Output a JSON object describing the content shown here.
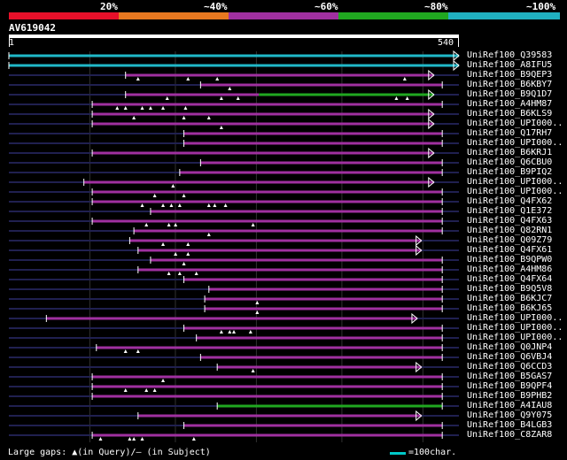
{
  "color_key": {
    "labels": [
      "20%",
      "~40%",
      "~60%",
      "~80%",
      "~100%"
    ],
    "colors": [
      "#e8102a",
      "#e87820",
      "#a030a0",
      "#20a820",
      "#20b0c0"
    ]
  },
  "query": {
    "name": "AV619042",
    "start": "1",
    "end": "540",
    "length": 540
  },
  "colors": {
    "hit": "#a030a0",
    "hit_cyan": "#20b8c8",
    "hit_green": "#20a820",
    "gap_line": "#202050",
    "grid": "#303030"
  },
  "legend": {
    "text": "Large gaps: ▲(in Query)/– (in Subject)",
    "scale_label": "=100char."
  },
  "hits": [
    {
      "name": "UniRef100_Q39583",
      "start": 0,
      "end": 540,
      "color": "cyan",
      "arrow": true,
      "marks": []
    },
    {
      "name": "UniRef100_A8IFU5",
      "start": 0,
      "end": 540,
      "color": "cyan",
      "arrow": true,
      "marks": []
    },
    {
      "name": "UniRef100_B9QEP3",
      "start": 140,
      "end": 510,
      "color": "purple",
      "arrow": true,
      "marks": [
        155,
        215,
        250,
        475
      ]
    },
    {
      "name": "UniRef100_B6KBY7",
      "start": 230,
      "end": 520,
      "color": "purple",
      "arrow": false,
      "marks": [
        265
      ]
    },
    {
      "name": "UniRef100_B9Q1D7",
      "start": 140,
      "end": 510,
      "color": "mixed",
      "arrow": true,
      "marks": [
        190,
        255,
        275,
        465,
        478
      ]
    },
    {
      "name": "UniRef100_A4HM87",
      "start": 100,
      "end": 520,
      "color": "purple",
      "arrow": false,
      "marks": [
        130,
        140,
        160,
        170,
        185,
        212
      ]
    },
    {
      "name": "UniRef100_B6KLS9",
      "start": 100,
      "end": 510,
      "color": "purple",
      "arrow": true,
      "marks": [
        150,
        210,
        240
      ]
    },
    {
      "name": "UniRef100_UPI000..",
      "start": 100,
      "end": 510,
      "color": "purple",
      "arrow": true,
      "marks": [
        255
      ]
    },
    {
      "name": "UniRef100_Q17RH7",
      "start": 210,
      "end": 520,
      "color": "purple",
      "arrow": false,
      "marks": []
    },
    {
      "name": "UniRef100_UPI000..",
      "start": 210,
      "end": 520,
      "color": "purple",
      "arrow": false,
      "marks": []
    },
    {
      "name": "UniRef100_B6KRJ1",
      "start": 100,
      "end": 510,
      "color": "purple",
      "arrow": true,
      "marks": []
    },
    {
      "name": "UniRef100_Q6CBU0",
      "start": 230,
      "end": 520,
      "color": "purple",
      "arrow": false,
      "marks": []
    },
    {
      "name": "UniRef100_B9PIQ2",
      "start": 205,
      "end": 520,
      "color": "purple",
      "arrow": false,
      "marks": []
    },
    {
      "name": "UniRef100_UPI000..",
      "start": 90,
      "end": 510,
      "color": "purple",
      "arrow": true,
      "marks": [
        197
      ]
    },
    {
      "name": "UniRef100_UPI000..",
      "start": 100,
      "end": 520,
      "color": "purple",
      "arrow": false,
      "marks": [
        175,
        210
      ]
    },
    {
      "name": "UniRef100_Q4FX62",
      "start": 100,
      "end": 520,
      "color": "purple",
      "arrow": false,
      "marks": [
        160,
        185,
        195,
        205,
        240,
        247,
        260
      ]
    },
    {
      "name": "UniRef100_Q1E372",
      "start": 170,
      "end": 520,
      "color": "purple",
      "arrow": false,
      "marks": []
    },
    {
      "name": "UniRef100_Q4FX63",
      "start": 100,
      "end": 520,
      "color": "purple",
      "arrow": false,
      "marks": [
        165,
        192,
        200,
        293
      ]
    },
    {
      "name": "UniRef100_Q82RN1",
      "start": 150,
      "end": 520,
      "color": "purple",
      "arrow": false,
      "marks": [
        240
      ]
    },
    {
      "name": "UniRef100_Q09Z79",
      "start": 145,
      "end": 495,
      "color": "purple",
      "arrow": true,
      "marks": [
        185,
        215
      ]
    },
    {
      "name": "UniRef100_Q4FX61",
      "start": 155,
      "end": 495,
      "color": "purple",
      "arrow": true,
      "marks": [
        200,
        215
      ]
    },
    {
      "name": "UniRef100_B9QPW0",
      "start": 170,
      "end": 520,
      "color": "purple",
      "arrow": false,
      "marks": [
        210
      ]
    },
    {
      "name": "UniRef100_A4HM86",
      "start": 155,
      "end": 520,
      "color": "purple",
      "arrow": false,
      "marks": [
        192,
        205,
        225
      ]
    },
    {
      "name": "UniRef100_Q4FX64",
      "start": 210,
      "end": 520,
      "color": "purple",
      "arrow": false,
      "marks": []
    },
    {
      "name": "UniRef100_B9Q5V8",
      "start": 240,
      "end": 520,
      "color": "purple",
      "arrow": false,
      "marks": []
    },
    {
      "name": "UniRef100_B6KJC7",
      "start": 235,
      "end": 520,
      "color": "purple",
      "arrow": false,
      "marks": [
        298
      ]
    },
    {
      "name": "UniRef100_B6KJ65",
      "start": 235,
      "end": 520,
      "color": "purple",
      "arrow": false,
      "marks": [
        298
      ]
    },
    {
      "name": "UniRef100_UPI000..",
      "start": 45,
      "end": 490,
      "color": "purple",
      "arrow": true,
      "marks": []
    },
    {
      "name": "UniRef100_UPI000..",
      "start": 210,
      "end": 520,
      "color": "purple",
      "arrow": false,
      "marks": [
        255,
        265,
        270,
        290
      ]
    },
    {
      "name": "UniRef100_UPI000..",
      "start": 225,
      "end": 520,
      "color": "purple",
      "arrow": false,
      "marks": []
    },
    {
      "name": "UniRef100_Q0JNP4",
      "start": 105,
      "end": 520,
      "color": "purple",
      "arrow": false,
      "marks": [
        140,
        155
      ]
    },
    {
      "name": "UniRef100_Q6VBJ4",
      "start": 230,
      "end": 520,
      "color": "purple",
      "arrow": false,
      "marks": []
    },
    {
      "name": "UniRef100_Q6CCD3",
      "start": 250,
      "end": 495,
      "color": "purple",
      "arrow": true,
      "marks": [
        293
      ]
    },
    {
      "name": "UniRef100_B5GAS7",
      "start": 100,
      "end": 520,
      "color": "purple",
      "arrow": false,
      "marks": [
        185
      ]
    },
    {
      "name": "UniRef100_B9QPF4",
      "start": 100,
      "end": 520,
      "color": "purple",
      "arrow": false,
      "marks": [
        140,
        165,
        175
      ]
    },
    {
      "name": "UniRef100_B9PHB2",
      "start": 100,
      "end": 520,
      "color": "purple",
      "arrow": false,
      "marks": []
    },
    {
      "name": "UniRef100_A4IAU8",
      "start": 250,
      "end": 520,
      "color": "green",
      "arrow": false,
      "marks": []
    },
    {
      "name": "UniRef100_Q9Y075",
      "start": 155,
      "end": 495,
      "color": "purple",
      "arrow": true,
      "marks": []
    },
    {
      "name": "UniRef100_B4LGB3",
      "start": 210,
      "end": 520,
      "color": "purple",
      "arrow": false,
      "marks": []
    },
    {
      "name": "UniRef100_C8ZAR8",
      "start": 100,
      "end": 520,
      "color": "purple",
      "arrow": false,
      "marks": [
        110,
        145,
        150,
        160,
        222
      ]
    }
  ]
}
